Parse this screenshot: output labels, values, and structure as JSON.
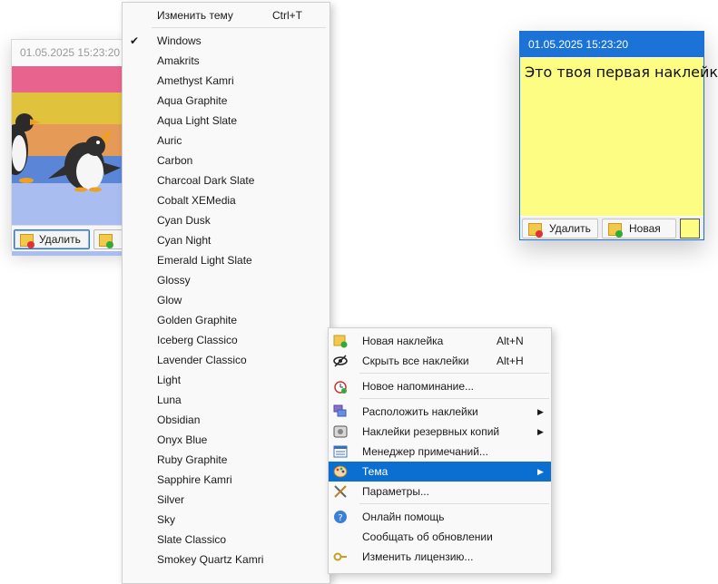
{
  "left_note": {
    "timestamp": "01.05.2025 15:23:20",
    "delete_label": "Удалить",
    "stripe_colors": [
      "#e8648f",
      "#e0c23c",
      "#e59a58",
      "#5b86d8",
      "#a9bdf0"
    ]
  },
  "right_note": {
    "timestamp": "01.05.2025 15:23:20",
    "text": "Это твоя первая наклейка!",
    "delete_label": "Удалить",
    "new_label": "Новая",
    "note_color": "#fdfd83",
    "header_color": "#1b73d8"
  },
  "theme_menu": {
    "change_theme_label": "Изменить тему",
    "change_theme_shortcut": "Ctrl+T",
    "checked_item": "Windows",
    "items": [
      "Windows",
      "Amakrits",
      "Amethyst Kamri",
      "Aqua Graphite",
      "Aqua Light Slate",
      "Auric",
      "Carbon",
      "Charcoal Dark Slate",
      "Cobalt XEMedia",
      "Cyan Dusk",
      "Cyan Night",
      "Emerald Light Slate",
      "Glossy",
      "Glow",
      "Golden Graphite",
      "Iceberg Classico",
      "Lavender Classico",
      "Light",
      "Luna",
      "Obsidian",
      "Onyx Blue",
      "Ruby Graphite",
      "Sapphire Kamri",
      "Silver",
      "Sky",
      "Slate Classico",
      "Smokey Quartz Kamri"
    ]
  },
  "context_menu": {
    "new_note": "Новая наклейка",
    "new_note_shortcut": "Alt+N",
    "hide_all": "Скрыть все наклейки",
    "hide_all_shortcut": "Alt+H",
    "new_reminder": "Новое напоминание...",
    "arrange": "Расположить наклейки",
    "backup": "Наклейки резервных копий",
    "notes_manager": "Менеджер примечаний...",
    "theme": "Тема",
    "settings": "Параметры...",
    "online_help": "Онлайн помощь",
    "check_updates": "Сообщать об обновлении",
    "change_license": "Изменить лицензию..."
  }
}
